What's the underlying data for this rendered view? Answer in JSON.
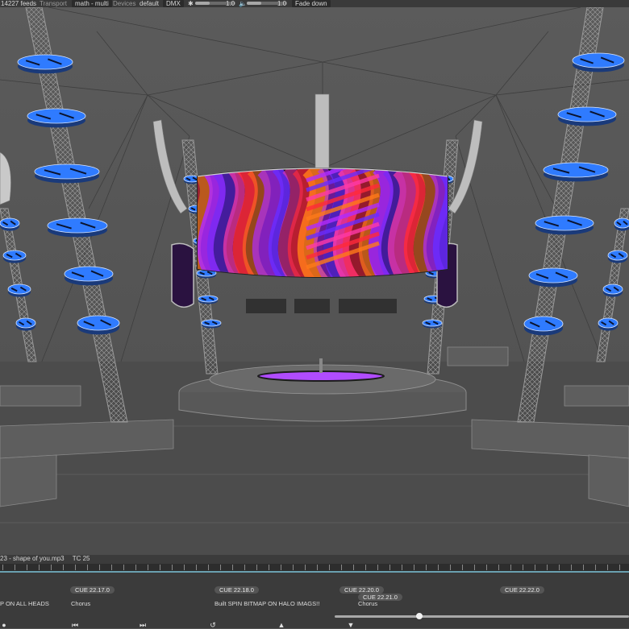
{
  "topbar": {
    "feeds": "14227 feeds",
    "transport_label": "Transport",
    "transport_value": "math - multi",
    "devices_label": "Devices",
    "devices_value": "default",
    "dmx_label": "DMX",
    "slider1_value": "1.0",
    "slider2_value": "1.0",
    "fade_button": "Fade down",
    "slider1_level": 0.35,
    "slider2_level": 0.35
  },
  "stage": {
    "screen_colors": [
      "#ff2a3a",
      "#ff7a1a",
      "#b02cff",
      "#6a2cff",
      "#ff3aa8"
    ],
    "ring_color": "#2f7bff",
    "disc_color": "#b04cff"
  },
  "timeline": {
    "track_name": "23 - shape of you.mp3",
    "timecode": "TC 25",
    "cues": [
      {
        "tag": "CUE 22.17.0",
        "label": "Chorus"
      },
      {
        "tag": "CUE 22.18.0",
        "label": "Built   SPIN BITMAP ON HALO IMAGS!!"
      },
      {
        "tag": "CUE 22.20.0",
        "label": ""
      },
      {
        "tag": "CUE 22.21.0",
        "label": "Chorus"
      },
      {
        "tag": "CUE 22.22.0",
        "label": ""
      }
    ],
    "left_cue_label": "P ON ALL HEADS",
    "playhead_position": 0.28
  },
  "transport_icons": [
    "skip-back-icon",
    "skip-forward-icon",
    "loop-icon",
    "eject-icon",
    "marker-down-icon",
    "record-dot-icon"
  ]
}
